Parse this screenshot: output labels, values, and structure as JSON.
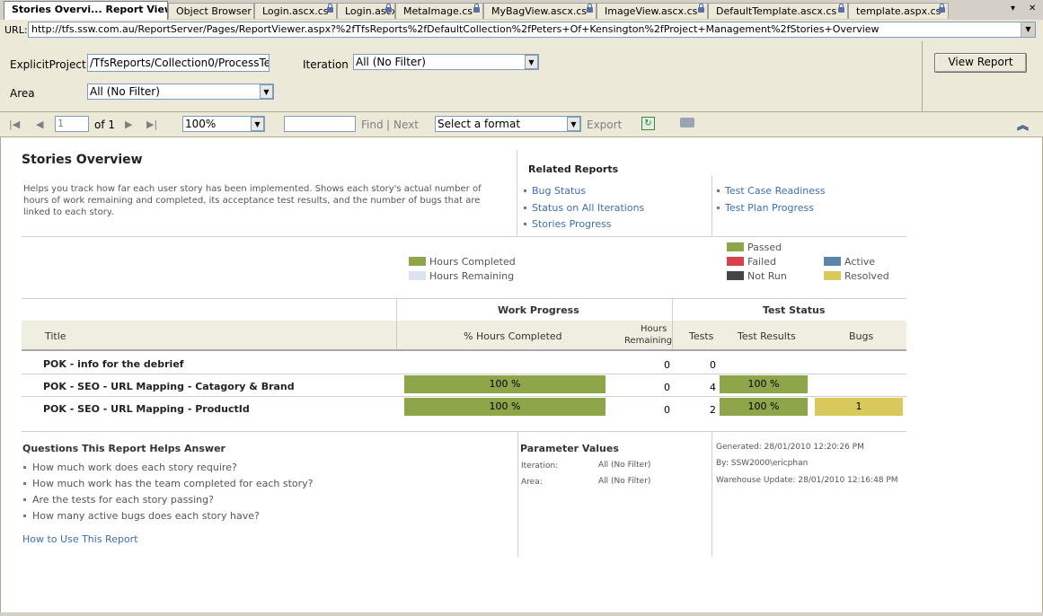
{
  "tabs": [
    {
      "label": "Stories Overvi... Report Viewer",
      "active": true,
      "locked": false
    },
    {
      "label": "Object Browser",
      "active": false,
      "locked": false
    },
    {
      "label": "Login.ascx.cs",
      "active": false,
      "locked": true
    },
    {
      "label": "Login.ascx",
      "active": false,
      "locked": true
    },
    {
      "label": "MetaImage.cs",
      "active": false,
      "locked": true
    },
    {
      "label": "MyBagView.ascx.cs",
      "active": false,
      "locked": true
    },
    {
      "label": "ImageView.ascx.cs",
      "active": false,
      "locked": true
    },
    {
      "label": "DefaultTemplate.ascx.cs",
      "active": false,
      "locked": true
    },
    {
      "label": "template.aspx.cs",
      "active": false,
      "locked": true
    }
  ],
  "tab_controls": {
    "dropdown": "▾",
    "close": "✕"
  },
  "url": {
    "label": "URL:",
    "value": "http://tfs.ssw.com.au/ReportServer/Pages/ReportViewer.aspx?%2fTfsReports%2fDefaultCollection%2fPeters+Of+Kensington%2fProject+Management%2fStories+Overview"
  },
  "params": {
    "explicit_project_label": "ExplicitProject",
    "explicit_project_value": "/TfsReports/Collection0/ProcessTe",
    "iteration_label": "Iteration",
    "iteration_value": "All (No Filter)",
    "area_label": "Area",
    "area_value": "All (No Filter)",
    "view_report": "View Report"
  },
  "toolbar": {
    "page": "1",
    "of": "of 1",
    "zoom": "100%",
    "find": "Find",
    "sep": "|",
    "next": "Next",
    "format": "Select a format",
    "export": "Export"
  },
  "report": {
    "title": "Stories Overview",
    "description": "Helps you track how far each user story has been implemented. Shows each story's actual number of hours of work remaining and completed, its acceptance test results, and the number of bugs that are linked to each story.",
    "related_title": "Related Reports",
    "related_left": [
      "Bug Status",
      "Status on All Iterations",
      "Stories Progress"
    ],
    "related_right": [
      "Test Case Readiness",
      "Test Plan Progress"
    ],
    "legend_work": [
      {
        "label": "Hours Completed",
        "color": "#8ea54a"
      },
      {
        "label": "Hours Remaining",
        "color": "#dde3ea"
      }
    ],
    "legend_test": [
      {
        "label": "Passed",
        "color": "#8ea54a"
      },
      {
        "label": "Failed",
        "color": "#d9414f"
      },
      {
        "label": "Not Run",
        "color": "#454545"
      },
      {
        "label": "Active",
        "color": "#5b86a8"
      },
      {
        "label": "Resolved",
        "color": "#d9c95c"
      }
    ],
    "table": {
      "group_work": "Work Progress",
      "group_test": "Test Status",
      "col_title": "Title",
      "col_pct": "% Hours Completed",
      "col_remaining_1": "Hours",
      "col_remaining_2": "Remaining",
      "col_tests": "Tests",
      "col_results": "Test Results",
      "col_bugs": "Bugs",
      "rows": [
        {
          "title": "POK - info for the debrief",
          "pct": "",
          "remaining": "0",
          "tests": "0",
          "results": "",
          "bugs": ""
        },
        {
          "title": "POK - SEO - URL Mapping - Catagory & Brand",
          "pct": "100 %",
          "remaining": "0",
          "tests": "4",
          "results": "100 %",
          "bugs": ""
        },
        {
          "title": "POK - SEO - URL Mapping - ProductId",
          "pct": "100 %",
          "remaining": "0",
          "tests": "2",
          "results": "100 %",
          "bugs": "1"
        }
      ]
    },
    "questions_title": "Questions This Report Helps Answer",
    "questions": [
      "How much work does each story require?",
      "How much work has the team completed for each story?",
      "Are the tests for each story passing?",
      "How many active bugs does each story have?"
    ],
    "how_to": "How to Use This Report",
    "param_values_title": "Parameter Values",
    "param_values": [
      {
        "name": "Iteration:",
        "value": "All (No Filter)"
      },
      {
        "name": "Area:",
        "value": "All (No Filter)"
      }
    ],
    "generated": "Generated: 28/01/2010 12:20:26 PM",
    "by": "By: SSW2000\\ericphan",
    "warehouse": "Warehouse Update: 28/01/2010 12:16:48 PM"
  }
}
